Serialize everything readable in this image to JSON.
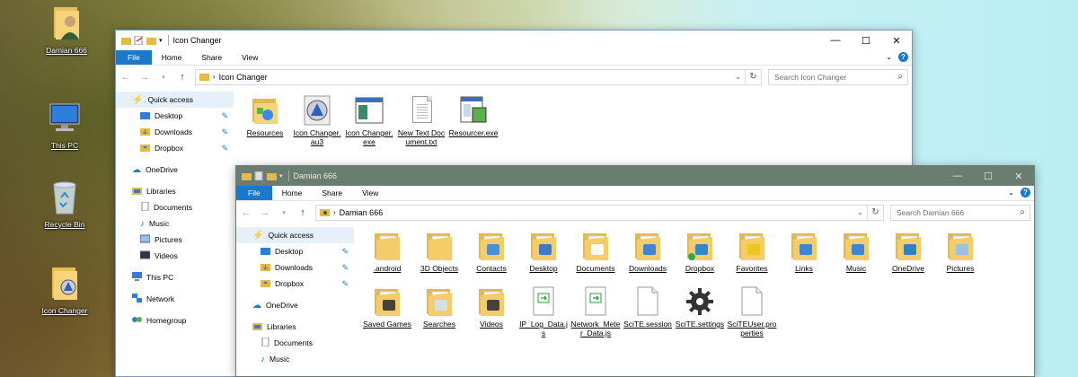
{
  "desktop": {
    "icons": [
      {
        "label": "Damian 666",
        "icon": "user-folder-icon"
      },
      {
        "label": "This PC",
        "icon": "computer-icon"
      },
      {
        "label": "Recycle Bin",
        "icon": "recycle-bin-icon"
      },
      {
        "label": "Icon Changer",
        "icon": "icon-changer-folder-icon"
      }
    ]
  },
  "win1": {
    "title": "Icon Changer",
    "tabs": [
      "File",
      "Home",
      "Share",
      "View"
    ],
    "address": "Icon Changer",
    "search_placeholder": "Search Icon Changer",
    "nav": {
      "quick_access": "Quick access",
      "desktop": "Desktop",
      "downloads": "Downloads",
      "dropbox": "Dropbox",
      "onedrive": "OneDrive",
      "libraries": "Libraries",
      "documents": "Documents",
      "music": "Music",
      "pictures": "Pictures",
      "videos": "Videos",
      "this_pc": "This PC",
      "network": "Network",
      "homegroup": "Homegroup"
    },
    "files": [
      {
        "name": "Resources",
        "icon": "resources-folder-icon"
      },
      {
        "name": "Icon Changer.au3",
        "icon": "au3-script-icon"
      },
      {
        "name": "Icon Changer.exe",
        "icon": "exe-window-icon"
      },
      {
        "name": "New Text Document.txt",
        "icon": "text-document-icon"
      },
      {
        "name": "Resourcer.exe",
        "icon": "resourcer-exe-icon"
      }
    ]
  },
  "win2": {
    "title": "Damian 666",
    "tabs": [
      "File",
      "Home",
      "Share",
      "View"
    ],
    "address": "Damian 666",
    "search_placeholder": "Search Damian 666",
    "nav": {
      "quick_access": "Quick access",
      "desktop": "Desktop",
      "downloads": "Downloads",
      "dropbox": "Dropbox",
      "onedrive": "OneDrive",
      "libraries": "Libraries",
      "documents": "Documents",
      "music": "Music"
    },
    "files": [
      {
        "name": ".android",
        "icon": "folder-icon"
      },
      {
        "name": "3D Objects",
        "icon": "folder-icon"
      },
      {
        "name": "Contacts",
        "icon": "contacts-folder-icon"
      },
      {
        "name": "Desktop",
        "icon": "desktop-folder-icon"
      },
      {
        "name": "Documents",
        "icon": "documents-folder-icon"
      },
      {
        "name": "Downloads",
        "icon": "downloads-folder-icon"
      },
      {
        "name": "Dropbox",
        "icon": "dropbox-folder-icon"
      },
      {
        "name": "Favorites",
        "icon": "favorites-folder-icon"
      },
      {
        "name": "Links",
        "icon": "links-folder-icon"
      },
      {
        "name": "Music",
        "icon": "music-folder-icon"
      },
      {
        "name": "OneDrive",
        "icon": "onedrive-folder-icon"
      },
      {
        "name": "Pictures",
        "icon": "pictures-folder-icon"
      },
      {
        "name": "Saved Games",
        "icon": "saved-games-folder-icon"
      },
      {
        "name": "Searches",
        "icon": "searches-folder-icon"
      },
      {
        "name": "Videos",
        "icon": "videos-folder-icon"
      },
      {
        "name": "IP_Log_Data.js",
        "icon": "js-file-icon"
      },
      {
        "name": "Network_Meter_Data.js",
        "icon": "js-file-icon"
      },
      {
        "name": "SciTE.session",
        "icon": "blank-file-icon"
      },
      {
        "name": "SciTE.settings",
        "icon": "settings-gear-icon"
      },
      {
        "name": "SciTEUser.properties",
        "icon": "blank-file-icon"
      }
    ]
  },
  "colors": {
    "accent": "#1979ca",
    "folder": "#f2c55a",
    "inactive_titlebar": "#6b7d70"
  }
}
